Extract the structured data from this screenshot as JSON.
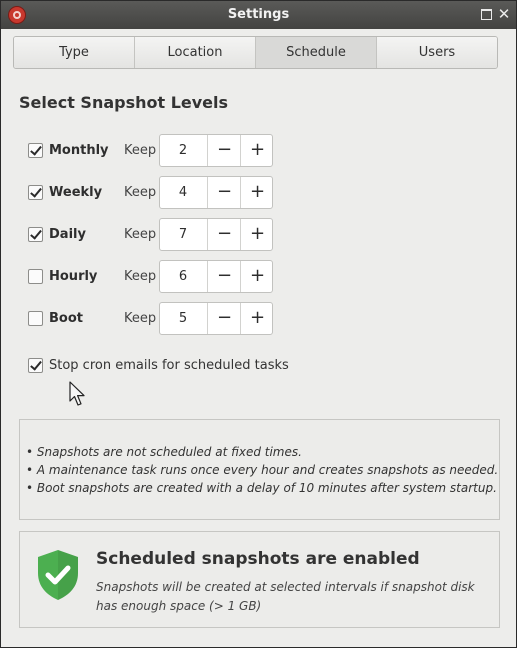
{
  "window": {
    "title": "Settings",
    "app_icon": "timeshift-icon"
  },
  "tabs": [
    {
      "label": "Type",
      "active": false
    },
    {
      "label": "Location",
      "active": false
    },
    {
      "label": "Schedule",
      "active": true
    },
    {
      "label": "Users",
      "active": false
    }
  ],
  "schedule": {
    "heading": "Select Snapshot Levels",
    "keep_label": "Keep",
    "decrement": "−",
    "increment": "+",
    "levels": [
      {
        "name": "Monthly",
        "checked": true,
        "keep": "2"
      },
      {
        "name": "Weekly",
        "checked": true,
        "keep": "4"
      },
      {
        "name": "Daily",
        "checked": true,
        "keep": "7"
      },
      {
        "name": "Hourly",
        "checked": false,
        "keep": "6"
      },
      {
        "name": "Boot",
        "checked": false,
        "keep": "5"
      }
    ],
    "stop_cron": {
      "label": "Stop cron emails for scheduled tasks",
      "checked": true
    }
  },
  "notes": [
    "• Snapshots are not scheduled at fixed times.",
    "• A maintenance task runs once every hour and creates snapshots as needed.",
    "• Boot snapshots are created with a delay of 10 minutes after system startup."
  ],
  "status": {
    "icon": "shield-check-icon",
    "title": "Scheduled snapshots are enabled",
    "description": "Snapshots will be created at selected intervals if snapshot disk has enough space (> 1 GB)",
    "color": "#4caf50"
  }
}
